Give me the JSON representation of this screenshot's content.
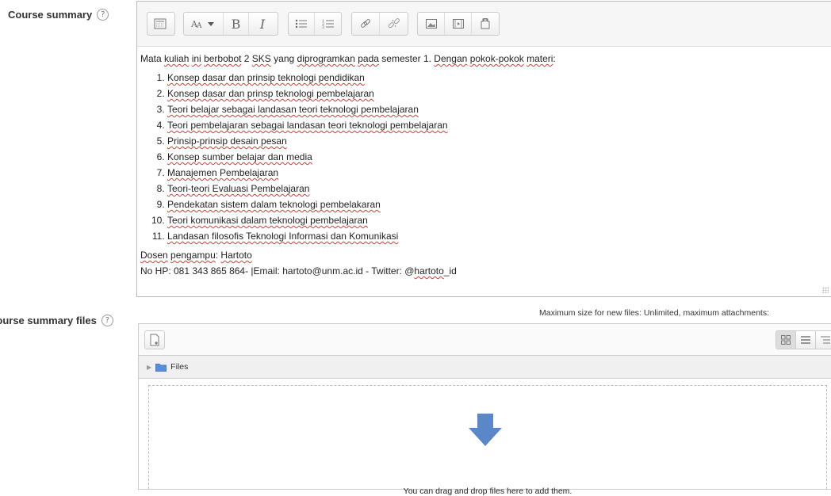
{
  "course_summary": {
    "label": "Course summary",
    "help": "?",
    "intro": [
      {
        "t": "Mata ",
        "s": false
      },
      {
        "t": "kuliah",
        "s": true
      },
      {
        "t": " ",
        "s": false
      },
      {
        "t": "ini",
        "s": true
      },
      {
        "t": " ",
        "s": false
      },
      {
        "t": "berbobot",
        "s": true
      },
      {
        "t": " 2 ",
        "s": false
      },
      {
        "t": "SKS",
        "s": true
      },
      {
        "t": " yang ",
        "s": false
      },
      {
        "t": "diprogramkan",
        "s": true
      },
      {
        "t": " ",
        "s": false
      },
      {
        "t": "pada",
        "s": true
      },
      {
        "t": " semester 1. ",
        "s": false
      },
      {
        "t": "Dengan",
        "s": true
      },
      {
        "t": " ",
        "s": false
      },
      {
        "t": "pokok-pokok",
        "s": true
      },
      {
        "t": " ",
        "s": false
      },
      {
        "t": "materi",
        "s": true
      },
      {
        "t": ":",
        "s": false
      }
    ],
    "list_items": [
      "Konsep dasar dan prinsip teknologi pendidikan",
      "Konsep dasar dan prinsp teknologi pembelajaran",
      "Teori belajar sebagai landasan teori teknologi pembelajaran",
      "Teori pembelajaran sebagai landasan teori teknologi pembelajaran",
      "Prinsip-prinsip desain pesan",
      "Konsep sumber belajar dan media",
      "Manajemen Pembelajaran",
      "Teori-teori Evaluasi Pembelajaran",
      "Pendekatan sistem dalam teknologi pembelakaran",
      "Teori komunikasi dalam teknologi pembelajaran",
      "Landasan filosofis Teknologi Informasi dan Komunikasi"
    ],
    "lecturer": [
      {
        "t": "Dosen",
        "s": true
      },
      {
        "t": " ",
        "s": false
      },
      {
        "t": "pengampu",
        "s": true
      },
      {
        "t": ": ",
        "s": false
      },
      {
        "t": "Hartoto",
        "s": true
      }
    ],
    "contact": [
      {
        "t": "No HP: 081 343 865 864- |Email: hartoto@unm.ac.id - Twitter: @",
        "s": false
      },
      {
        "t": "hartoto",
        "s": true
      },
      {
        "t": "_id",
        "s": false
      }
    ]
  },
  "toolbar_icons": {
    "groups": [
      [
        "show-more-icon"
      ],
      [
        "font-size-icon",
        "bold-icon",
        "italic-icon"
      ],
      [
        "unordered-list-icon",
        "ordered-list-icon"
      ],
      [
        "link-icon",
        "unlink-icon"
      ],
      [
        "image-icon",
        "media-icon",
        "manage-files-icon"
      ]
    ],
    "bold_glyph": "B",
    "italic_glyph": "I"
  },
  "summary_files": {
    "label": "Course summary files",
    "help": "?",
    "max_size_text": "Maximum size for new files: Unlimited, maximum attachments:",
    "folder_name": "Files",
    "drop_text": "You can drag and drop files here to add them.",
    "arrow_color": "#5b87c9"
  }
}
